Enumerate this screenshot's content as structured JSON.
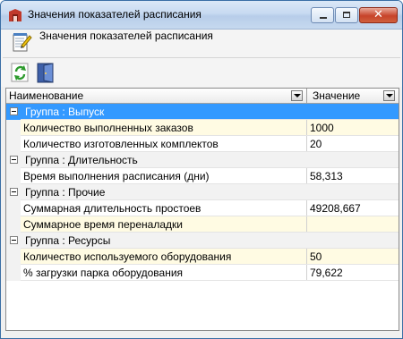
{
  "window": {
    "title": "Значения показателей расписания",
    "header_text": "Значения показателей расписания",
    "close_glyph": "✕"
  },
  "toolbar": {
    "buttons": [
      {
        "name": "refresh",
        "icon": "refresh-icon"
      },
      {
        "name": "exit",
        "icon": "exit-door-icon"
      }
    ]
  },
  "grid": {
    "columns": [
      "Наименование",
      "Значение"
    ],
    "groups": [
      {
        "label": "Группа : Выпуск",
        "selected": true,
        "items": [
          {
            "name": "Количество выполненных заказов",
            "value": "1000"
          },
          {
            "name": "Количество изготовленных комплектов",
            "value": "20"
          }
        ]
      },
      {
        "label": "Группа : Длительность",
        "items": [
          {
            "name": "Время выполнения расписания (дни)",
            "value": "58,313"
          }
        ]
      },
      {
        "label": "Группа : Прочие",
        "items": [
          {
            "name": "Суммарная длительность простоев",
            "value": "49208,667"
          },
          {
            "name": "Суммарное время переналадки",
            "value": ""
          }
        ]
      },
      {
        "label": "Группа : Ресурсы",
        "items": [
          {
            "name": "Количество используемого оборудования",
            "value": "50"
          },
          {
            "name": "% загрузки парка оборудования",
            "value": "79,622"
          }
        ]
      }
    ]
  },
  "colors": {
    "selection": "#3399ff",
    "alt_row": "#fffbe3",
    "titlebar": "#c7daf1"
  }
}
